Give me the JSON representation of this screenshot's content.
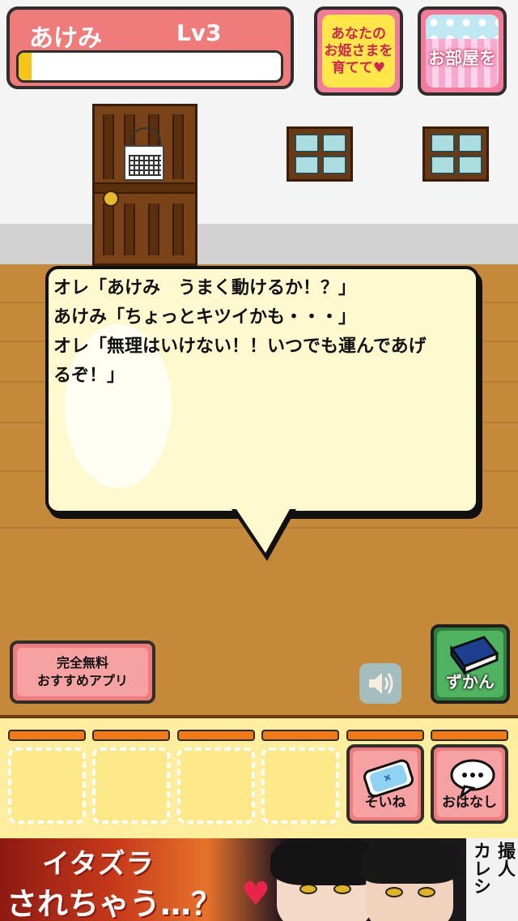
{
  "status": {
    "name": "あけみ",
    "level": "Lv3",
    "exp_fraction": 0.05
  },
  "top_buttons": {
    "princess_label_lines": [
      "あなたの",
      "お姫さまを",
      "育てて♥"
    ],
    "room_label": "お部屋を"
  },
  "dialog": {
    "lines": [
      "オレ「あけみ　うまく動けるか！？」",
      "あけみ「ちょっとキツイかも・・・」",
      "オレ「無理はいけない！！いつでも運んであげ",
      "るぞ！」"
    ]
  },
  "buttons": {
    "free_apps_lines": [
      "完全無料",
      "おすすめアプリ"
    ],
    "sound_icon": "speaker-icon",
    "zukan_label": "ずかん",
    "soine_label": "そいね",
    "ohanashi_label": "おはなし"
  },
  "item_slots": 4,
  "ad": {
    "title_line1": "イタズラ",
    "title_line2": "されちゃう…？",
    "heart": "♥",
    "side_lines": [
      "撮人",
      "カレシ"
    ]
  },
  "colors": {
    "status_bg": "#f07b7b",
    "exp_fill": "#f5c518",
    "floor": "#c48a3a",
    "bubble": "#fff9cf",
    "item_bar": "#ffee9e",
    "slot_top": "#f07a1a",
    "zukan_green": "#4fb35f"
  }
}
